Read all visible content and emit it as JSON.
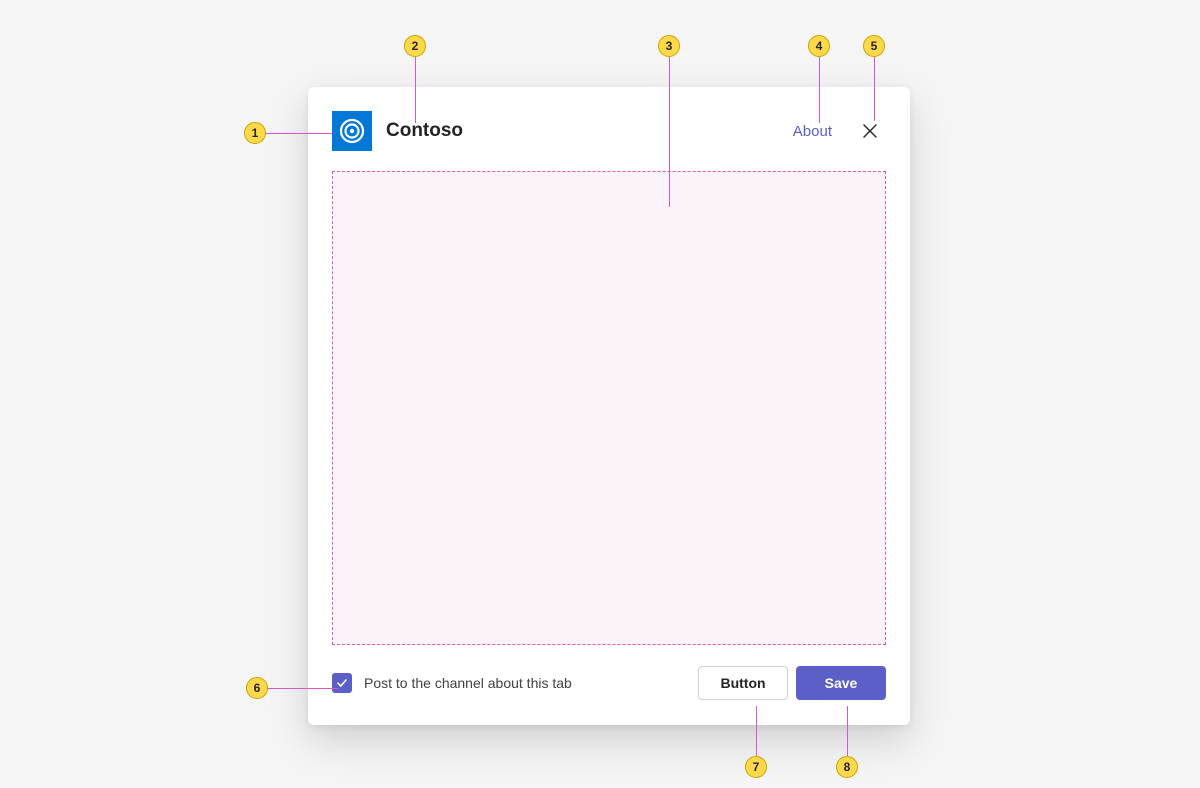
{
  "dialog": {
    "app_name": "Contoso",
    "about_label": "About",
    "checkbox_label": "Post to the channel about this tab",
    "checkbox_checked": true,
    "secondary_button": "Button",
    "primary_button": "Save"
  },
  "callouts": {
    "c1": "1",
    "c2": "2",
    "c3": "3",
    "c4": "4",
    "c5": "5",
    "c6": "6",
    "c7": "7",
    "c8": "8"
  }
}
